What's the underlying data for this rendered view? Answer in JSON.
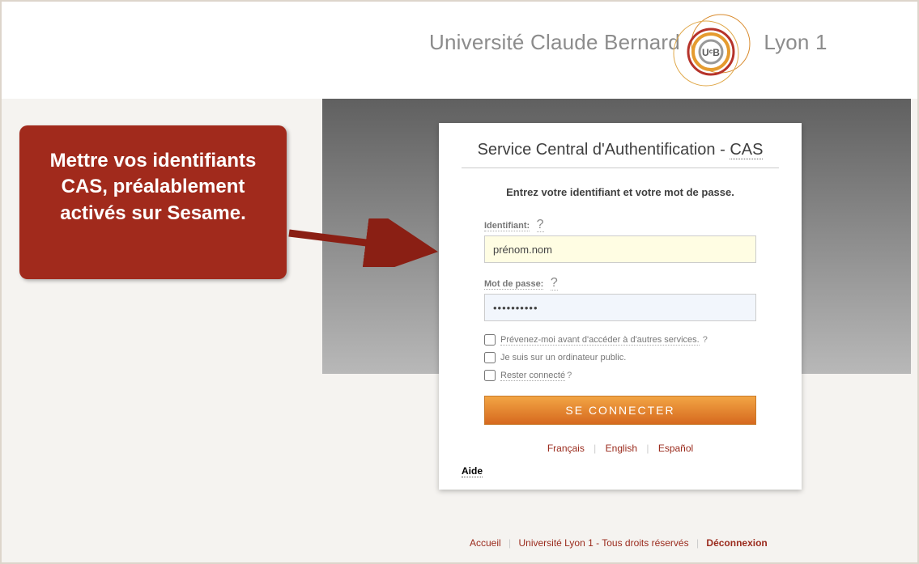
{
  "brand": {
    "left": "Université Claude Bernard",
    "right": "Lyon 1"
  },
  "callout": "Mettre vos identifiants CAS, préalablement activés sur Sesame.",
  "card": {
    "title_pre": "Service Central d'Authentification - ",
    "title_abbr": "CAS",
    "instruction": "Entrez votre identifiant et votre mot de passe.",
    "username_label": "Identifiant:",
    "username_value": "prénom.nom",
    "password_label": "Mot de passe:",
    "password_value": "••••••••••",
    "help_mark": "?",
    "chk1": "Prévenez-moi avant d'accéder à d'autres services.",
    "chk2": "Je suis sur un ordinateur public.",
    "chk3": "Rester connecté",
    "submit": "SE CONNECTER",
    "aide": "Aide"
  },
  "langs": {
    "fr": "Français",
    "en": "English",
    "es": "Español"
  },
  "footer": {
    "home": "Accueil",
    "rights": "Université Lyon 1 - Tous droits réservés",
    "logout": "Déconnexion"
  }
}
